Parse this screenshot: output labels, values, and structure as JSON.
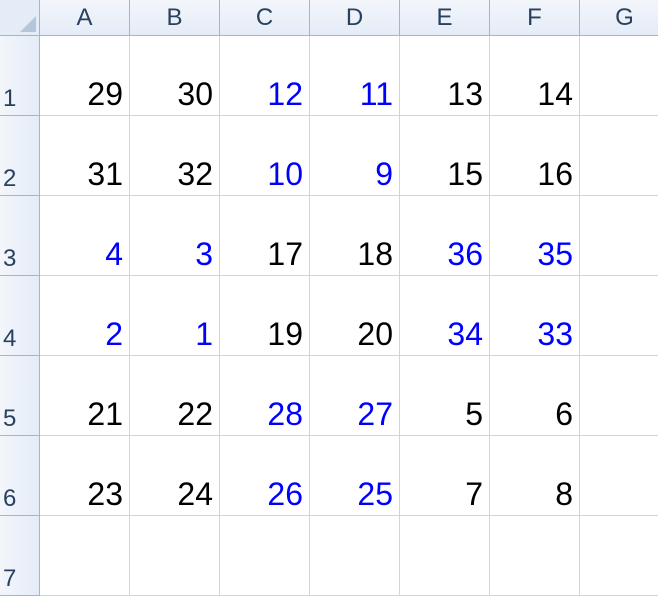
{
  "columns": [
    "A",
    "B",
    "C",
    "D",
    "E",
    "F",
    "G"
  ],
  "rows": [
    {
      "label": "1",
      "cells": [
        {
          "v": "29",
          "color": "#000000"
        },
        {
          "v": "30",
          "color": "#000000"
        },
        {
          "v": "12",
          "color": "#0000ff"
        },
        {
          "v": "11",
          "color": "#0000ff"
        },
        {
          "v": "13",
          "color": "#000000"
        },
        {
          "v": "14",
          "color": "#000000"
        },
        {
          "v": "",
          "color": "#000000"
        }
      ]
    },
    {
      "label": "2",
      "cells": [
        {
          "v": "31",
          "color": "#000000"
        },
        {
          "v": "32",
          "color": "#000000"
        },
        {
          "v": "10",
          "color": "#0000ff"
        },
        {
          "v": "9",
          "color": "#0000ff"
        },
        {
          "v": "15",
          "color": "#000000"
        },
        {
          "v": "16",
          "color": "#000000"
        },
        {
          "v": "",
          "color": "#000000"
        }
      ]
    },
    {
      "label": "3",
      "cells": [
        {
          "v": "4",
          "color": "#0000ff"
        },
        {
          "v": "3",
          "color": "#0000ff"
        },
        {
          "v": "17",
          "color": "#000000"
        },
        {
          "v": "18",
          "color": "#000000"
        },
        {
          "v": "36",
          "color": "#0000ff"
        },
        {
          "v": "35",
          "color": "#0000ff"
        },
        {
          "v": "",
          "color": "#000000"
        }
      ]
    },
    {
      "label": "4",
      "cells": [
        {
          "v": "2",
          "color": "#0000ff"
        },
        {
          "v": "1",
          "color": "#0000ff"
        },
        {
          "v": "19",
          "color": "#000000"
        },
        {
          "v": "20",
          "color": "#000000"
        },
        {
          "v": "34",
          "color": "#0000ff"
        },
        {
          "v": "33",
          "color": "#0000ff"
        },
        {
          "v": "",
          "color": "#000000"
        }
      ]
    },
    {
      "label": "5",
      "cells": [
        {
          "v": "21",
          "color": "#000000"
        },
        {
          "v": "22",
          "color": "#000000"
        },
        {
          "v": "28",
          "color": "#0000ff"
        },
        {
          "v": "27",
          "color": "#0000ff"
        },
        {
          "v": "5",
          "color": "#000000"
        },
        {
          "v": "6",
          "color": "#000000"
        },
        {
          "v": "",
          "color": "#000000"
        }
      ]
    },
    {
      "label": "6",
      "cells": [
        {
          "v": "23",
          "color": "#000000"
        },
        {
          "v": "24",
          "color": "#000000"
        },
        {
          "v": "26",
          "color": "#0000ff"
        },
        {
          "v": "25",
          "color": "#0000ff"
        },
        {
          "v": "7",
          "color": "#000000"
        },
        {
          "v": "8",
          "color": "#000000"
        },
        {
          "v": "",
          "color": "#000000"
        }
      ]
    },
    {
      "label": "7",
      "cells": [
        {
          "v": "",
          "color": "#000000"
        },
        {
          "v": "",
          "color": "#000000"
        },
        {
          "v": "",
          "color": "#000000"
        },
        {
          "v": "",
          "color": "#000000"
        },
        {
          "v": "",
          "color": "#000000"
        },
        {
          "v": "",
          "color": "#000000"
        },
        {
          "v": "",
          "color": "#000000"
        }
      ]
    }
  ]
}
